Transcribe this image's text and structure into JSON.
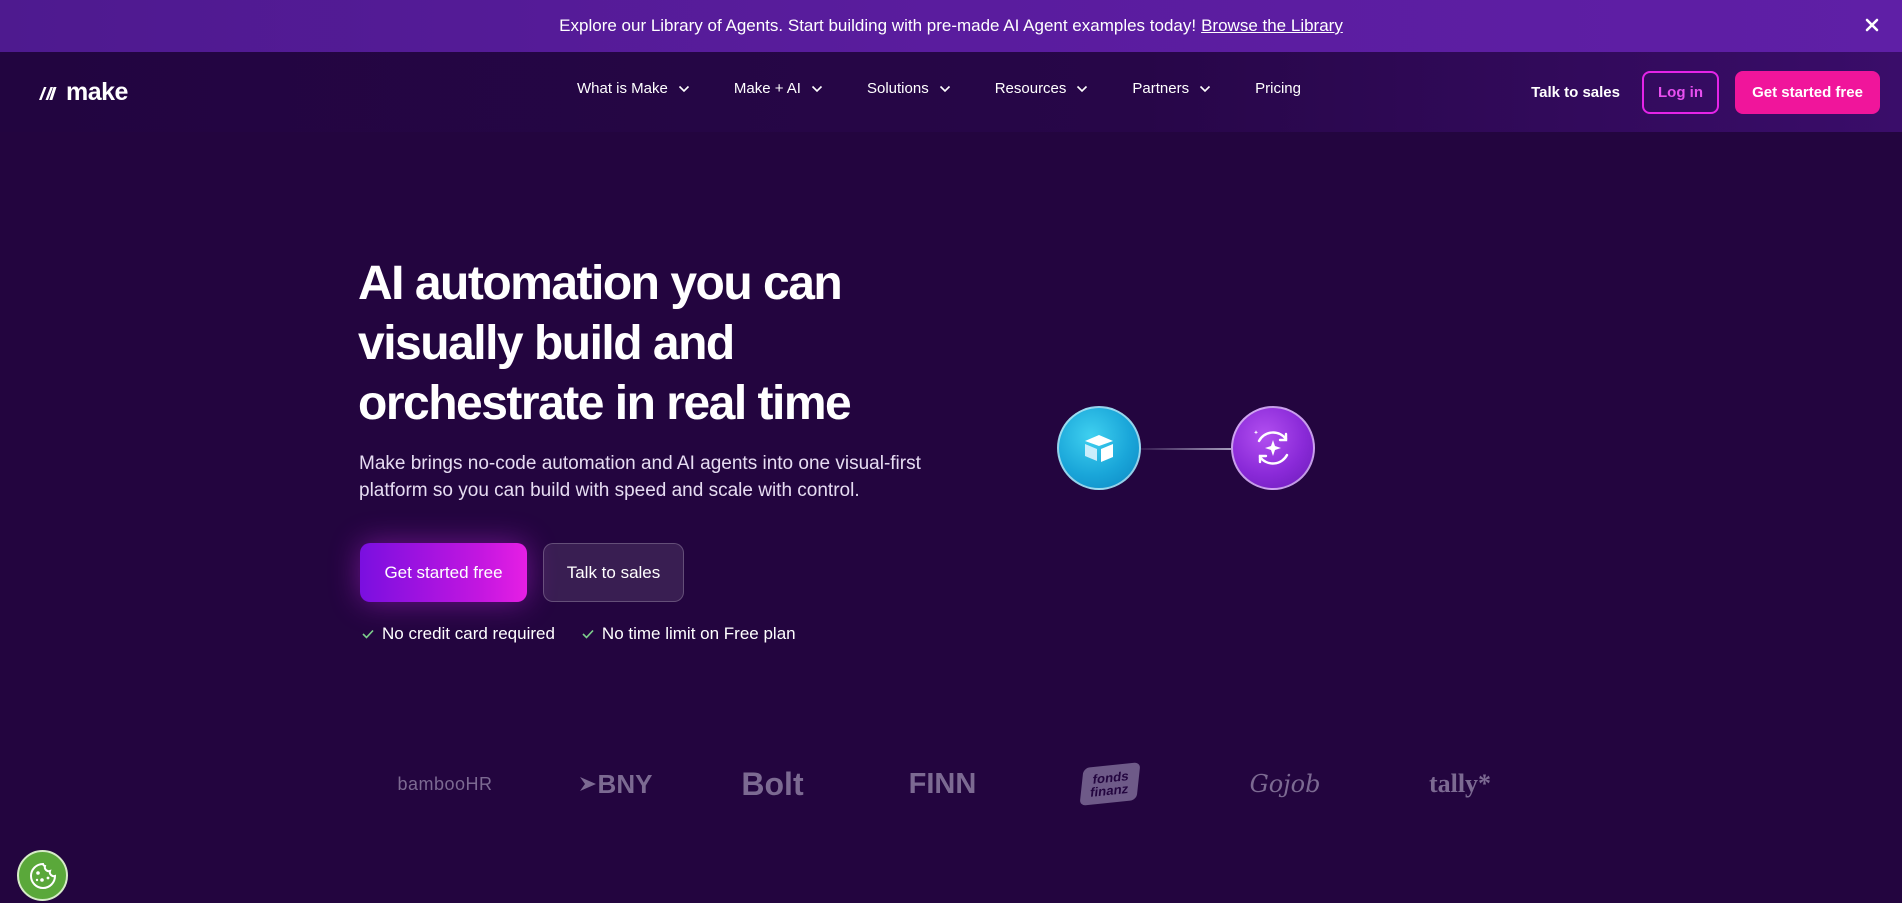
{
  "banner": {
    "text": "Explore our Library of Agents. Start building with pre-made AI Agent examples today!",
    "link": "Browse the Library",
    "close_icon": "close-icon"
  },
  "header": {
    "logo_text": "make",
    "nav": [
      {
        "label": "What is Make",
        "dropdown": true
      },
      {
        "label": "Make + AI",
        "dropdown": true
      },
      {
        "label": "Solutions",
        "dropdown": true
      },
      {
        "label": "Resources",
        "dropdown": true
      },
      {
        "label": "Partners",
        "dropdown": true
      },
      {
        "label": "Pricing",
        "dropdown": false
      }
    ],
    "talk_to_sales": "Talk to sales",
    "login": "Log in",
    "get_started": "Get started free"
  },
  "hero": {
    "title_line1": "AI automation you can",
    "title_line2": "visually build and",
    "title_line3": "orchestrate in real time",
    "subtitle": "Make brings no-code automation and AI agents into one visual-first platform so you can build with speed and scale with control.",
    "cta_primary": "Get started free",
    "cta_secondary": "Talk to sales",
    "perks": [
      "No credit card required",
      "No time limit on Free plan"
    ]
  },
  "diagram": {
    "node_a_icon": "airtable-box-icon",
    "node_b_icon": "ai-sparkle-sync-icon"
  },
  "logos": {
    "bamboohr": "bambooHR",
    "bny": "BNY",
    "bolt": "Bolt",
    "finn": "FINN",
    "fondsfinanz_line1": "fonds",
    "fondsfinanz_line2": "finanz",
    "gojob": "Gojob",
    "tally": "tally*"
  },
  "colors": {
    "background": "#23053f",
    "banner": "#5a1c9e",
    "accent_pink": "#f0159b",
    "login_border": "#e524e8"
  }
}
